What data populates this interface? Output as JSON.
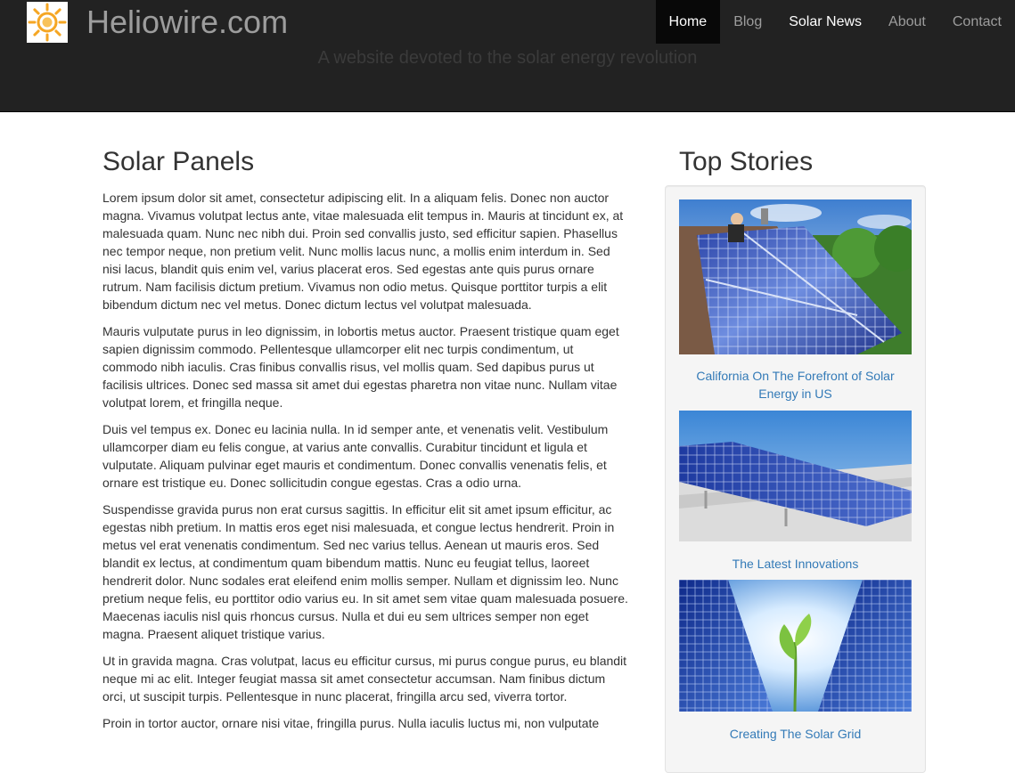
{
  "header": {
    "brand": "Heliowire.com",
    "tagline": "A website devoted to the solar energy revolution",
    "logo_icon": "sun-icon",
    "nav": [
      {
        "label": "Home",
        "active": true
      },
      {
        "label": "Blog"
      },
      {
        "label": "Solar News"
      },
      {
        "label": "About"
      },
      {
        "label": "Contact"
      }
    ]
  },
  "main": {
    "title": "Solar Panels",
    "paragraphs": [
      "Lorem ipsum dolor sit amet, consectetur adipiscing elit. In a aliquam felis. Donec non auctor magna. Vivamus volutpat lectus ante, vitae malesuada elit tempus in. Mauris at tincidunt ex, at malesuada quam. Nunc nec nibh dui. Proin sed convallis justo, sed efficitur sapien. Phasellus nec tempor neque, non pretium velit. Nunc mollis lacus nunc, a mollis enim interdum in. Sed nisi lacus, blandit quis enim vel, varius placerat eros. Sed egestas ante quis purus ornare rutrum. Nam facilisis dictum pretium. Vivamus non odio metus. Quisque porttitor turpis a elit bibendum dictum nec vel metus. Donec dictum lectus vel volutpat malesuada.",
      "Mauris vulputate purus in leo dignissim, in lobortis metus auctor. Praesent tristique quam eget sapien dignissim commodo. Pellentesque ullamcorper elit nec turpis condimentum, ut commodo nibh iaculis. Cras finibus convallis risus, vel mollis quam. Sed dapibus purus ut facilisis ultrices. Donec sed massa sit amet dui egestas pharetra non vitae nunc. Nullam vitae volutpat lorem, et fringilla neque.",
      "Duis vel tempus ex. Donec eu lacinia nulla. In id semper ante, et venenatis velit. Vestibulum ullamcorper diam eu felis congue, at varius ante convallis. Curabitur tincidunt et ligula et vulputate. Aliquam pulvinar eget mauris et condimentum. Donec convallis venenatis felis, et ornare est tristique eu. Donec sollicitudin congue egestas. Cras a odio urna.",
      "Suspendisse gravida purus non erat cursus sagittis. In efficitur elit sit amet ipsum efficitur, ac egestas nibh pretium. In mattis eros eget nisi malesuada, et congue lectus hendrerit. Proin in metus vel erat venenatis condimentum. Sed nec varius tellus. Aenean ut mauris eros. Sed blandit ex lectus, at condimentum quam bibendum mattis. Nunc eu feugiat tellus, laoreet hendrerit dolor. Nunc sodales erat eleifend enim mollis semper. Nullam et dignissim leo. Nunc pretium neque felis, eu porttitor odio varius eu. In sit amet sem vitae quam malesuada posuere. Maecenas iaculis nisl quis rhoncus cursus. Nulla et dui eu sem ultrices semper non eget magna. Praesent aliquet tristique varius.",
      "Ut in gravida magna. Cras volutpat, lacus eu efficitur cursus, mi purus congue purus, eu blandit neque mi ac elit. Integer feugiat massa sit amet consectetur accumsan. Nam finibus dictum orci, ut suscipit turpis. Pellentesque in nunc placerat, fringilla arcu sed, viverra tortor.",
      "Proin in tortor auctor, ornare nisi vitae, fringilla purus. Nulla iaculis luctus mi, non vulputate"
    ]
  },
  "sidebar": {
    "title": "Top Stories",
    "stories": [
      {
        "caption": "California On The Forefront of Solar Energy in US",
        "image": "rooftop-solar-panels-image"
      },
      {
        "caption": "The Latest Innovations",
        "image": "solar-panel-array-image"
      },
      {
        "caption": "Creating The Solar Grid",
        "image": "solar-grid-sprout-image"
      }
    ]
  },
  "colors": {
    "header_bg": "#222222",
    "nav_active_bg": "#080808",
    "nav_text": "#9d9d9d",
    "link": "#337ab7",
    "body_text": "#333333",
    "well_bg": "#f5f5f5",
    "logo_sun": "#f5a623"
  }
}
